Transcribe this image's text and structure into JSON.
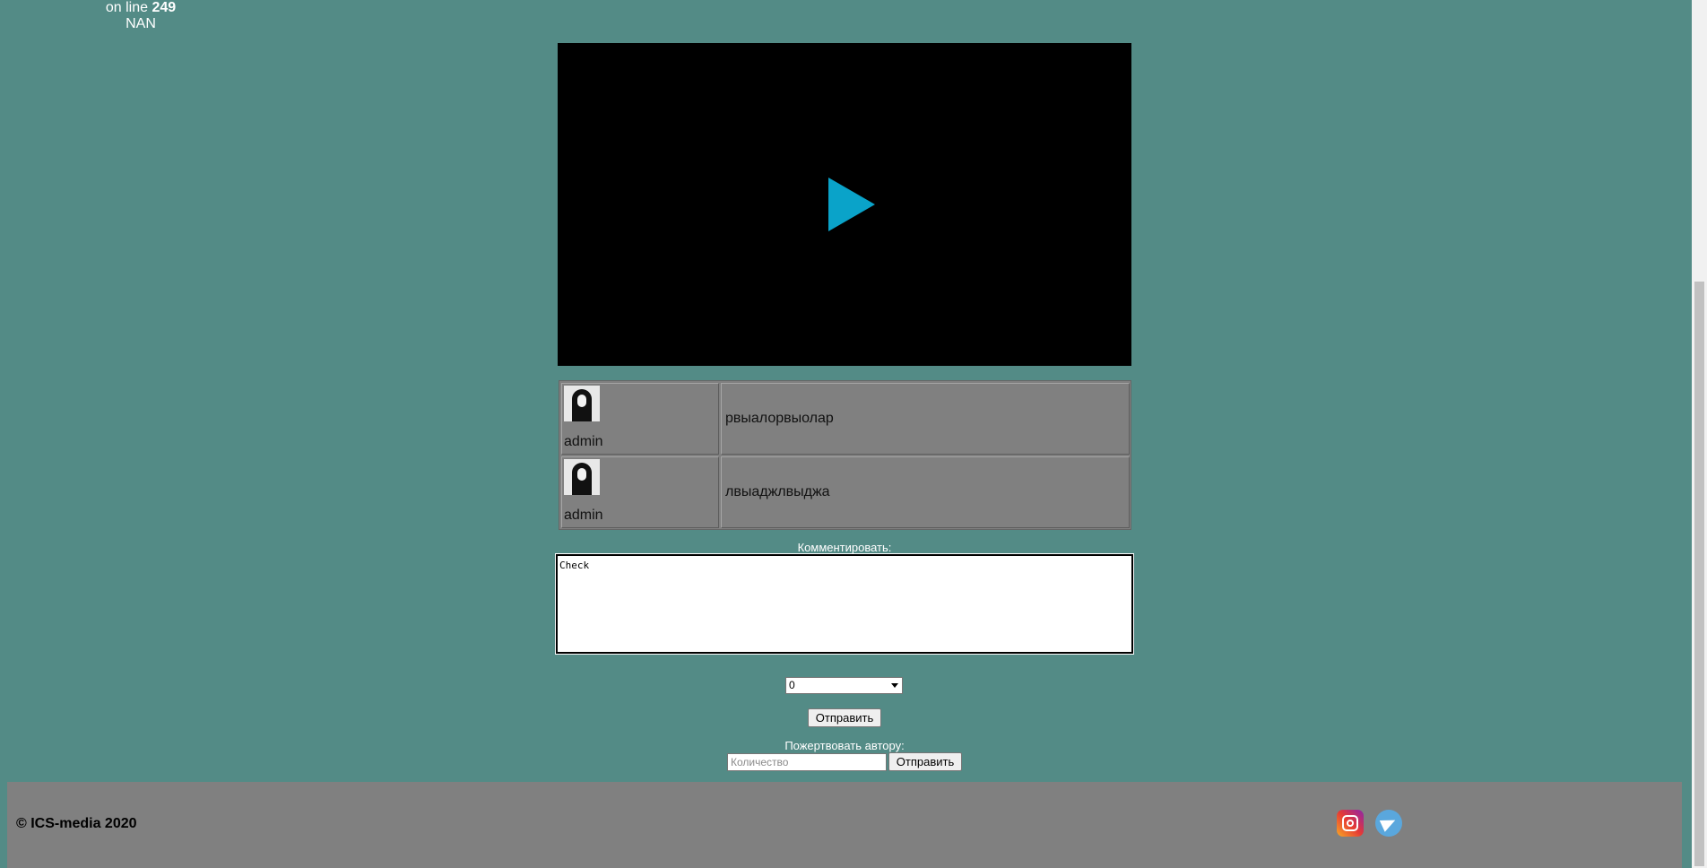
{
  "header": {
    "online_label": "on line",
    "online_count": "249",
    "status": "NAN"
  },
  "video": {
    "play_icon": "play-icon"
  },
  "comments": [
    {
      "author": "admin",
      "text": "рвыалорвыолар"
    },
    {
      "author": "admin",
      "text": "лвыаджлвыджа"
    }
  ],
  "comment_form": {
    "label": "Комментировать:",
    "textarea_value": "Check",
    "rating_selected": "0",
    "submit_label": "Отправить"
  },
  "donate": {
    "label": "Пожертвовать автору:",
    "amount_placeholder": "Количество",
    "submit_label": "Отправить"
  },
  "footer": {
    "copyright": "© ICS-media 2020",
    "social": [
      "instagram-icon",
      "telegram-icon"
    ]
  },
  "colors": {
    "background": "#538b86",
    "panel": "#808080",
    "play": "#0aa3c9"
  }
}
